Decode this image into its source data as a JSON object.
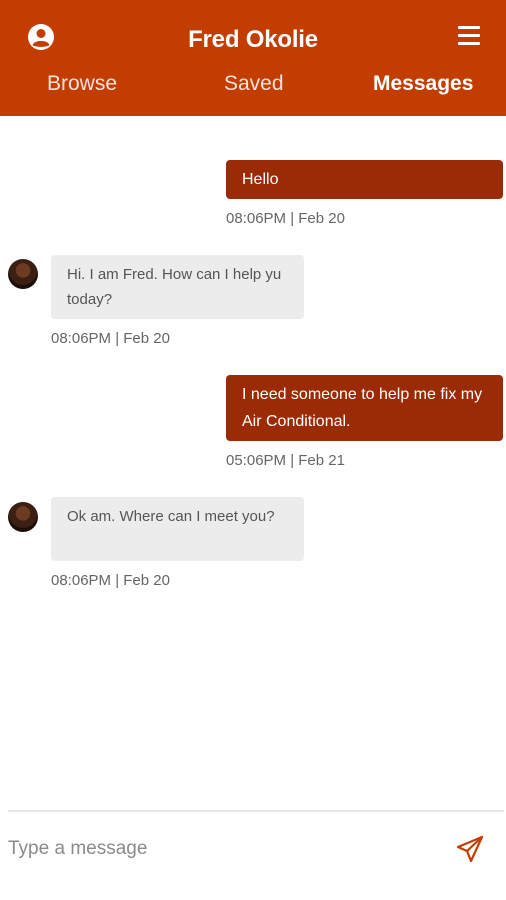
{
  "header": {
    "title": "Fred Okolie",
    "profile_icon": "user-circle-icon",
    "menu_icon": "hamburger-menu-icon",
    "background_color": "#c43d00",
    "tabs": [
      {
        "label": "Browse",
        "active": false
      },
      {
        "label": "Saved",
        "active": false
      },
      {
        "label": "Messages",
        "active": true
      }
    ]
  },
  "messages": [
    {
      "direction": "outgoing",
      "text": "Hello",
      "time": "08:06PM | Feb 20"
    },
    {
      "direction": "incoming",
      "text": "Hi. I am Fred. How can I help yu today?",
      "time": "08:06PM | Feb 20"
    },
    {
      "direction": "outgoing",
      "text": "I need someone to help me fix my Air Conditional.",
      "time": "05:06PM | Feb 21"
    },
    {
      "direction": "incoming",
      "text": "Ok am. Where can I meet you?",
      "time": "08:06PM | Feb 20"
    }
  ],
  "composer": {
    "placeholder": "Type a message",
    "send_icon": "paper-plane-icon",
    "send_color": "#c43d00"
  },
  "colors": {
    "outgoing_bubble": "#9b2b06",
    "incoming_bubble": "#ececec"
  }
}
